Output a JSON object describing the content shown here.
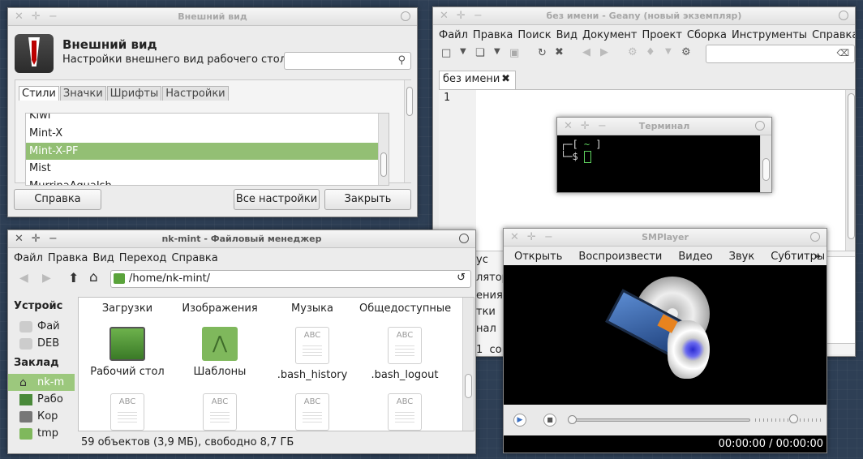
{
  "appearance": {
    "title": "Внешний вид",
    "heading": "Внешний вид",
    "subheading": "Настройки внешнего вид рабочего стола",
    "tabs": [
      "Стили",
      "Значки",
      "Шрифты",
      "Настройки"
    ],
    "themes": [
      "Kiwi",
      "Mint-X",
      "Mint-X-PF",
      "Mist",
      "MurrinaAquaIsh"
    ],
    "selected": "Mint-X-PF",
    "help": "Справка",
    "all_settings": "Все настройки",
    "close": "Закрыть",
    "search_icon": "search-icon"
  },
  "geany": {
    "title": "без имени - Geany (новый экземпляр)",
    "menu": [
      "Файл",
      "Правка",
      "Поиск",
      "Вид",
      "Документ",
      "Проект",
      "Сборка",
      "Инструменты",
      "Справка"
    ],
    "tab": "без имени",
    "line_number": "1",
    "side_fragments": [
      "ус",
      "лятор",
      "ения",
      "тки",
      "нал"
    ],
    "status_fragment": "1  со"
  },
  "terminal": {
    "title": "Терминал",
    "line1_a": "┌─[",
    "line1_tilde": "~",
    "line1_b": "]",
    "line2": "└─$"
  },
  "fm": {
    "title": "nk-mint - Файловый менеджер",
    "menu": [
      "Файл",
      "Правка",
      "Вид",
      "Переход",
      "Справка"
    ],
    "path": "/home/nk-mint/",
    "sections": {
      "devices": "Устройс",
      "bookmarks": "Заклад"
    },
    "devices": [
      "Фай",
      "DEB"
    ],
    "bookmarks": [
      "nk-m",
      "Рабо",
      "Кор",
      "tmp"
    ],
    "top_labels": [
      "Загрузки",
      "Изображения",
      "Музыка",
      "Общедоступные"
    ],
    "row1": [
      "Рабочий стол",
      "Шаблоны",
      ".bash_history",
      ".bash_logout"
    ],
    "icon_text": "ABC",
    "status": "59 объектов (3,9 МБ), свободно 8,7 ГБ"
  },
  "smplayer": {
    "title": "SMPlayer",
    "menu": [
      "Открыть",
      "Воспроизвести",
      "Видео",
      "Звук",
      "Субтитры"
    ],
    "more": "»",
    "time": "00:00:00 / 00:00:00",
    "progress": 0.0,
    "volume": 0.55
  }
}
